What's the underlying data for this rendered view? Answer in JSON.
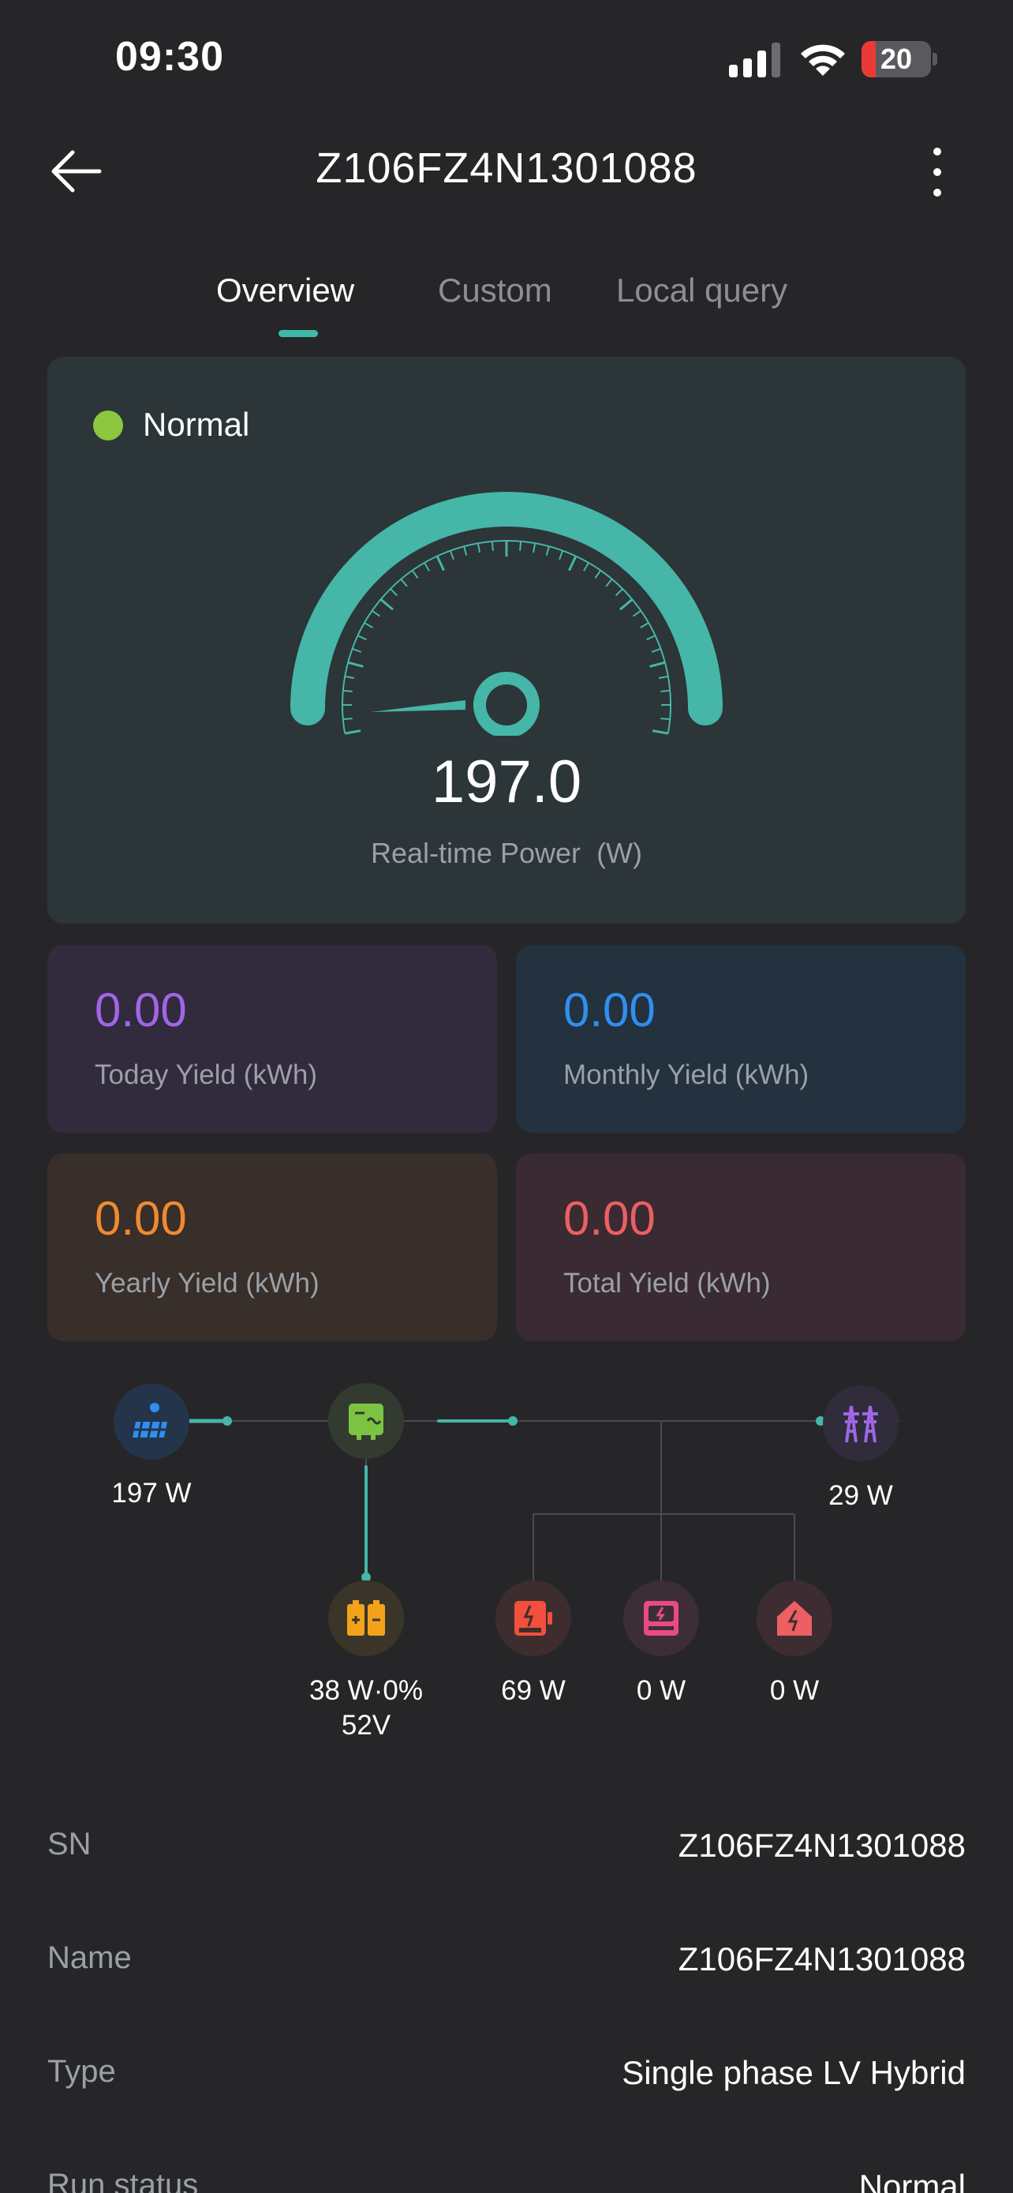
{
  "status_bar": {
    "time": "09:30",
    "battery_level": "20",
    "battery_fraction": 0.2
  },
  "nav": {
    "title": "Z106FZ4N1301088"
  },
  "tabs": [
    {
      "label": "Overview",
      "active": true
    },
    {
      "label": "Custom",
      "active": false
    },
    {
      "label": "Local query",
      "active": false
    }
  ],
  "gauge": {
    "status": "Normal",
    "value": "197.0",
    "label": "Real-time Power",
    "unit": "(W)"
  },
  "yields": [
    {
      "value": "0.00",
      "label": "Today Yield (kWh)",
      "color": "#a066e6"
    },
    {
      "value": "0.00",
      "label": "Monthly Yield (kWh)",
      "color": "#2f8ff0"
    },
    {
      "value": "0.00",
      "label": "Yearly Yield (kWh)",
      "color": "#f08a30"
    },
    {
      "value": "0.00",
      "label": "Total Yield (kWh)",
      "color": "#ec5f63"
    }
  ],
  "flow": {
    "pv": {
      "label": "197 W",
      "icon": "solar-panel-icon"
    },
    "inverter": {
      "icon": "inverter-icon"
    },
    "grid": {
      "label": "29 W",
      "icon": "power-tower-icon"
    },
    "battery": {
      "label_line1": "38 W·0%",
      "label_line2": "52V",
      "icon": "battery-icon"
    },
    "ups": {
      "label": "69 W",
      "icon": "ups-icon"
    },
    "smart": {
      "label": "0 W",
      "icon": "smart-load-icon"
    },
    "home": {
      "label": "0 W",
      "icon": "home-icon"
    }
  },
  "info": [
    {
      "key": "SN",
      "value": "Z106FZ4N1301088"
    },
    {
      "key": "Name",
      "value": "Z106FZ4N1301088"
    },
    {
      "key": "Type",
      "value": "Single phase LV Hybrid"
    },
    {
      "key": "Run status",
      "value": "Normal"
    }
  ],
  "colors": {
    "accent": "#3fb8a9",
    "status_normal": "#8dc63f",
    "background": "#262629"
  }
}
